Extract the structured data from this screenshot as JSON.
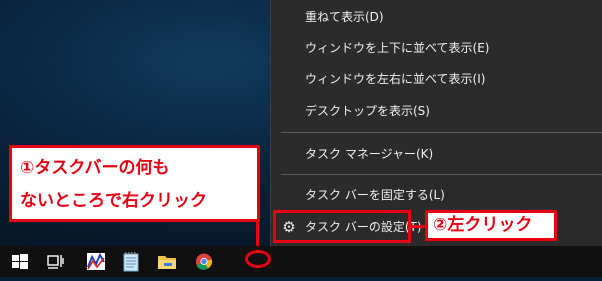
{
  "context_menu": {
    "items": [
      {
        "label": "重ねて表示(D)"
      },
      {
        "label": "ウィンドウを上下に並べて表示(E)"
      },
      {
        "label": "ウィンドウを左右に並べて表示(I)"
      },
      {
        "label": "デスクトップを表示(S)"
      },
      {
        "label": "タスク マネージャー(K)"
      },
      {
        "label": "タスク バーを固定する(L)"
      },
      {
        "label": "タスク バーの設定(T)"
      }
    ]
  },
  "annotations": {
    "callout1_line1": "①タスクバーの何も",
    "callout1_line2": "ないところで右クリック",
    "callout2": "②左クリック"
  },
  "colors": {
    "annotation_red": "#e60012",
    "menu_bg": "#2b2b2b",
    "taskbar_bg": "#101010"
  },
  "taskbar": {
    "icons": [
      "windows-start-icon",
      "task-view-icon",
      "app-graph-icon",
      "notepad-icon",
      "file-explorer-icon",
      "chrome-icon"
    ]
  }
}
